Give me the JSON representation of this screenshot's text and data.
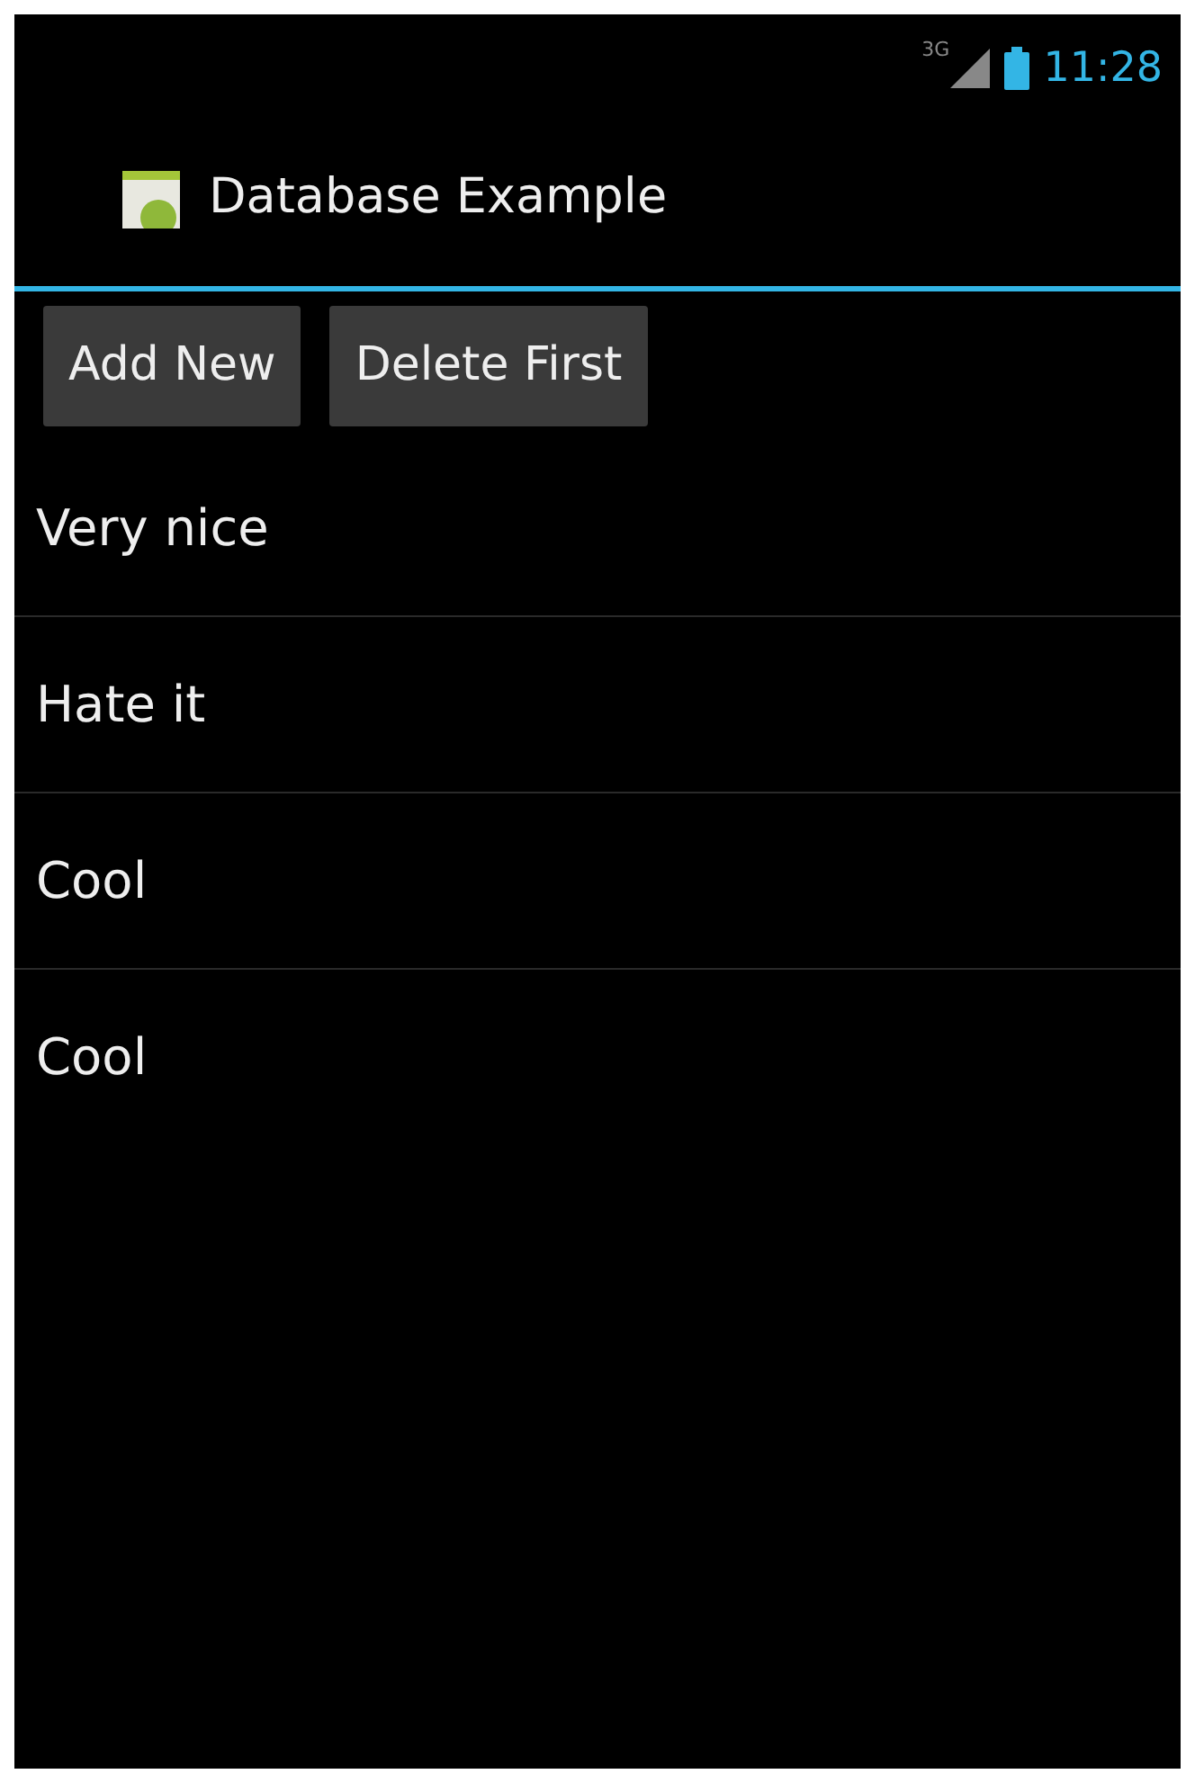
{
  "status_bar": {
    "network": "3G",
    "time": "11:28"
  },
  "action_bar": {
    "title": "Database Example"
  },
  "buttons": [
    "Add New",
    "Delete First"
  ],
  "items": [
    "Very nice",
    "Hate it",
    "Cool",
    "Cool"
  ]
}
